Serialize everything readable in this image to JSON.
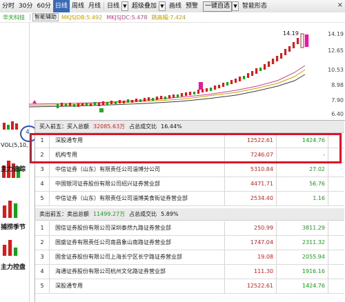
{
  "toolbar": {
    "items": [
      "分时",
      "30分",
      "60分",
      "日线",
      "周线",
      "月线",
      "日线",
      "超级叠加",
      "画线",
      "预警",
      "一键自选",
      "智能形态"
    ],
    "active_index": 3,
    "close_label": "×"
  },
  "infobar": {
    "stock_name": "华天科技",
    "indicator": "智能辅助",
    "ma1": "MKJSJDB:5.492",
    "ma2": "MKJSJDC:5.478",
    "ma3": "跳高幅:7.424"
  },
  "axis_labels": [
    "14.19",
    "12.65",
    "10.53",
    "8.98",
    "7.90",
    "6.40"
  ],
  "left_panel": {
    "circle_num": "4",
    "vol_label": "VOL(5,10,",
    "btn1": "主力追踪",
    "btn2": "捕捞季节",
    "btn3": "主力控盘"
  },
  "price_tag": "14.19",
  "buy": {
    "header": "买入前五：买入总额",
    "total": "32085.63万",
    "ratio_label": "占总成交比",
    "ratio": "16.44%",
    "rows": [
      {
        "idx": "1",
        "name": "深股通专用",
        "buy": "12522.61",
        "sell": "1424.76"
      },
      {
        "idx": "2",
        "name": "机构专用",
        "buy": "7246.07",
        "sell": "-"
      },
      {
        "idx": "3",
        "name": "中信证券（山东）有限责任公司淄博分公司",
        "buy": "5310.84",
        "sell": "27.02"
      },
      {
        "idx": "4",
        "name": "中国银河证券股份有限公司绍兴证券营业部",
        "buy": "4471.71",
        "sell": "56.76"
      },
      {
        "idx": "5",
        "name": "中信证券（山东）有限责任公司淄博美食街证券营业部",
        "buy": "2534.40",
        "sell": "1.16"
      }
    ]
  },
  "sell": {
    "header": "卖出前五：卖出总额",
    "total": "11499.27万",
    "ratio_label": "占总成交比",
    "ratio": "5.89%",
    "rows": [
      {
        "idx": "1",
        "name": "国信证券股份有限公司深圳泰然九路证券营业部",
        "buy": "250.99",
        "sell": "3811.29"
      },
      {
        "idx": "2",
        "name": "国盛证券有限责任公司南昌象山南路证券营业部",
        "buy": "1747.04",
        "sell": "2311.32"
      },
      {
        "idx": "3",
        "name": "国金证券股份有限公司上海长宁区长宁路证券营业部",
        "buy": "19.08",
        "sell": "2055.94"
      },
      {
        "idx": "4",
        "name": "海通证券股份有限公司杭州文化路证券营业部",
        "buy": "111.30",
        "sell": "1916.16"
      },
      {
        "idx": "5",
        "name": "深股通专用",
        "buy": "12522.61",
        "sell": "1424.76"
      }
    ]
  },
  "colors": {
    "up": "#d41d1d",
    "down": "#18a018",
    "accent": "#3b6ab2",
    "highlight_box": "#d8152a"
  }
}
